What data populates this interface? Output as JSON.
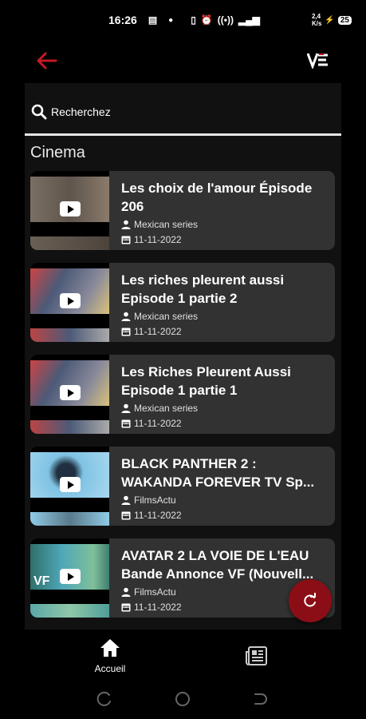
{
  "status_bar": {
    "time": "16:26",
    "net_speed_top": "2,4",
    "net_speed_bottom": "K/s",
    "battery": "25"
  },
  "app_bar": {
    "back_icon": "arrow-left-icon",
    "logo_text": "V"
  },
  "search": {
    "placeholder": "Recherchez"
  },
  "section": {
    "title": "Cinema"
  },
  "videos": [
    {
      "title_line1": "Les choix de l'amour Épisode",
      "title_line2": "206",
      "channel": "Mexican series",
      "date": "11-11-2022",
      "thumb_top_color": "#6e665d",
      "thumb_bot_color": "#5b5148"
    },
    {
      "title_line1": "Les riches pleurent aussi",
      "title_line2": "Episode 1 partie 2",
      "channel": "Mexican series",
      "date": "11-11-2022",
      "thumb_top_color": "#4c5a78",
      "thumb_bot_color": "#6a5a6e"
    },
    {
      "title_line1": "Les Riches Pleurent Aussi",
      "title_line2": "Episode 1 partie 1",
      "channel": "Mexican series",
      "date": "11-11-2022",
      "thumb_top_color": "#4c5a78",
      "thumb_bot_color": "#6a5a6e"
    },
    {
      "title_line1": "BLACK PANTHER 2 :",
      "title_line2": "WAKANDA FOREVER TV Sp...",
      "channel": "FilmsActu",
      "date": "11-11-2022",
      "thumb_top_color": "#7fc3e4",
      "thumb_bot_color": "#8fcbe6"
    },
    {
      "title_line1": "AVATAR 2 LA VOIE DE L'EAU",
      "title_line2": "Bande Annonce VF (Nouvell...",
      "channel": "FilmsActu",
      "date": "11-11-2022",
      "thumb_top_color": "#3f8fa0",
      "thumb_bot_color": "#5aa7a8",
      "badge": "VF"
    }
  ],
  "fab": {
    "icon": "refresh-icon"
  },
  "bottom_nav": {
    "home_label": "Accueil",
    "home_icon": "home-icon",
    "news_icon": "newspaper-icon"
  },
  "colors": {
    "accent": "#8b0e16",
    "back_arrow": "#c41a24",
    "card_bg": "#323232",
    "panel_bg": "#111111"
  }
}
